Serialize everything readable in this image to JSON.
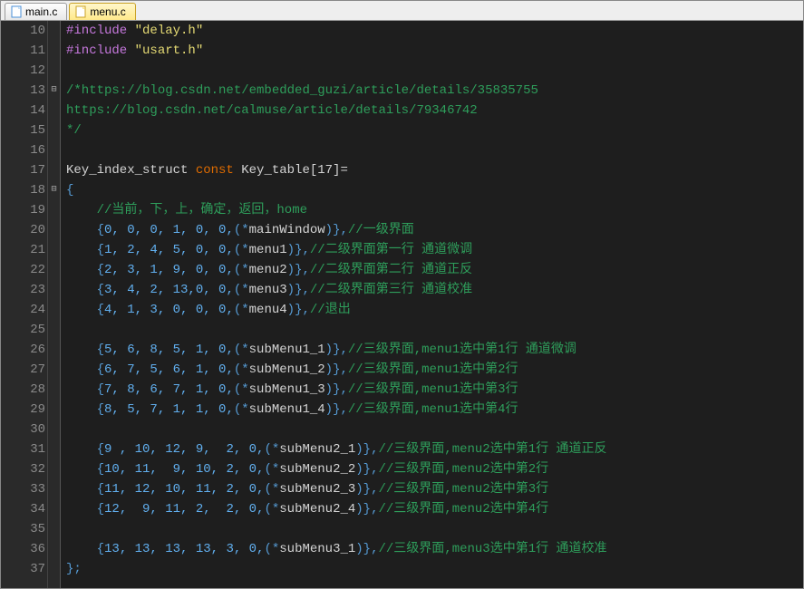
{
  "tabs": [
    {
      "label": "main.c",
      "active": false
    },
    {
      "label": "menu.c",
      "active": true
    }
  ],
  "first_line_number": 10,
  "code": {
    "l10": {
      "pre": "#include ",
      "str": "\"delay.h\""
    },
    "l11": {
      "pre": "#include ",
      "str": "\"usart.h\""
    },
    "l13": {
      "cmt": "/*https://blog.csdn.net/embedded_guzi/article/details/35835755"
    },
    "l14": {
      "cmt": "https://blog.csdn.net/calmuse/article/details/79346742"
    },
    "l15": {
      "cmt": "*/"
    },
    "l17": {
      "ident": "Key_index_struct ",
      "kw": "const",
      "rest": " Key_table[17]="
    },
    "l18": {
      "brace": "{"
    },
    "l19": {
      "cmt": "    //当前，下，上，确定，返回，home"
    },
    "l20": {
      "open": "    {",
      "nums": "0, 0, 0, 1, 0, 0,",
      "star": "(*",
      "fn": "mainWindow",
      "close": ")},",
      "cmt": "//一级界面"
    },
    "l21": {
      "open": "    {",
      "nums": "1, 2, 4, 5, 0, 0,",
      "star": "(*",
      "fn": "menu1",
      "close": ")},",
      "cmt": "//二级界面第一行 通道微调"
    },
    "l22": {
      "open": "    {",
      "nums": "2, 3, 1, 9, 0, 0,",
      "star": "(*",
      "fn": "menu2",
      "close": ")},",
      "cmt": "//二级界面第二行 通道正反"
    },
    "l23": {
      "open": "    {",
      "nums": "3, 4, 2, 13,0, 0,",
      "star": "(*",
      "fn": "menu3",
      "close": ")},",
      "cmt": "//二级界面第三行 通道校准"
    },
    "l24": {
      "open": "    {",
      "nums": "4, 1, 3, 0, 0, 0,",
      "star": "(*",
      "fn": "menu4",
      "close": ")},",
      "cmt": "//退出"
    },
    "l26": {
      "open": "    {",
      "nums": "5, 6, 8, 5, 1, 0,",
      "star": "(*",
      "fn": "subMenu1_1",
      "close": ")},",
      "cmt": "//三级界面,menu1选中第1行 通道微调"
    },
    "l27": {
      "open": "    {",
      "nums": "6, 7, 5, 6, 1, 0,",
      "star": "(*",
      "fn": "subMenu1_2",
      "close": ")},",
      "cmt": "//三级界面,menu1选中第2行"
    },
    "l28": {
      "open": "    {",
      "nums": "7, 8, 6, 7, 1, 0,",
      "star": "(*",
      "fn": "subMenu1_3",
      "close": ")},",
      "cmt": "//三级界面,menu1选中第3行"
    },
    "l29": {
      "open": "    {",
      "nums": "8, 5, 7, 1, 1, 0,",
      "star": "(*",
      "fn": "subMenu1_4",
      "close": ")},",
      "cmt": "//三级界面,menu1选中第4行"
    },
    "l31": {
      "open": "    {",
      "nums": "9 , 10, 12, 9,  2, 0,",
      "star": "(*",
      "fn": "subMenu2_1",
      "close": ")},",
      "cmt": "//三级界面,menu2选中第1行 通道正反"
    },
    "l32": {
      "open": "    {",
      "nums": "10, 11,  9, 10, 2, 0,",
      "star": "(*",
      "fn": "subMenu2_2",
      "close": ")},",
      "cmt": "//三级界面,menu2选中第2行"
    },
    "l33": {
      "open": "    {",
      "nums": "11, 12, 10, 11, 2, 0,",
      "star": "(*",
      "fn": "subMenu2_3",
      "close": ")},",
      "cmt": "//三级界面,menu2选中第3行"
    },
    "l34": {
      "open": "    {",
      "nums": "12,  9, 11, 2,  2, 0,",
      "star": "(*",
      "fn": "subMenu2_4",
      "close": ")},",
      "cmt": "//三级界面,menu2选中第4行"
    },
    "l36": {
      "open": "    {",
      "nums": "13, 13, 13, 13, 3, 0,",
      "star": "(*",
      "fn": "subMenu3_1",
      "close": ")},",
      "cmt": "//三级界面,menu3选中第1行 通道校准"
    },
    "l37": {
      "brace": "};"
    }
  },
  "fold_markers": {
    "13": "⊟",
    "18": "⊟"
  }
}
